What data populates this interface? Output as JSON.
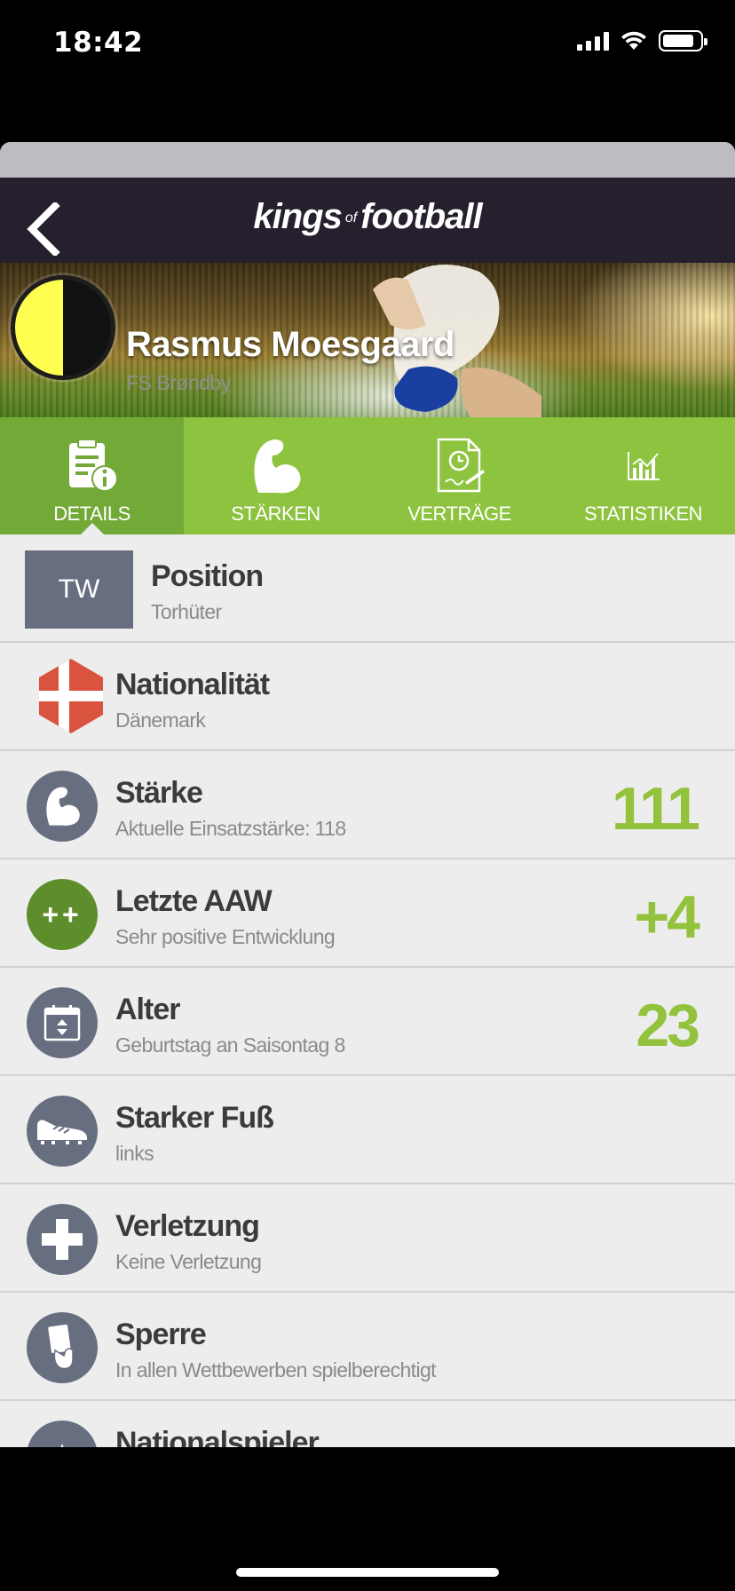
{
  "status": {
    "time": "18:42",
    "battery_level": 0.84
  },
  "app": {
    "logo_kings": "kings",
    "logo_of": "of",
    "logo_football": "football"
  },
  "player": {
    "name": "Rasmus Moesgaard",
    "club": "FS Brøndby",
    "club_colors": [
      "#ffff52",
      "#111111"
    ]
  },
  "tabs": [
    {
      "label": "DETAILS",
      "icon": "details-document-icon",
      "active": true
    },
    {
      "label": "STÄRKEN",
      "icon": "flexed-arm-icon",
      "active": false
    },
    {
      "label": "VERTRÄGE",
      "icon": "contract-icon",
      "active": false
    },
    {
      "label": "STATISTIKEN",
      "icon": "bar-chart-icon",
      "active": false
    }
  ],
  "details": {
    "position": {
      "badge": "TW",
      "title": "Position",
      "subtitle": "Torhüter"
    },
    "nationality": {
      "title": "Nationalität",
      "subtitle": "Dänemark",
      "icon": "denmark-flag-icon"
    },
    "strength": {
      "title": "Stärke",
      "subtitle": "Aktuelle Einsatzstärke: 118",
      "value": "111",
      "icon": "flexed-arm-icon"
    },
    "last_aaw": {
      "title": "Letzte AAW",
      "subtitle": "Sehr positive Entwicklung",
      "value": "+4",
      "icon": "double-plus-icon",
      "icon_text": "++"
    },
    "age": {
      "title": "Alter",
      "subtitle": "Geburtstag an Saisontag 8",
      "value": "23",
      "icon": "calendar-icon"
    },
    "foot": {
      "title": "Starker Fuß",
      "subtitle": "links",
      "icon": "football-boot-icon"
    },
    "injury": {
      "title": "Verletzung",
      "subtitle": "Keine Verletzung",
      "icon": "medical-cross-icon"
    },
    "suspension": {
      "title": "Sperre",
      "subtitle": "In allen Wettbewerben spielberechtigt",
      "icon": "referee-card-icon"
    },
    "national": {
      "title": "Nationalspieler",
      "icon": "star-icon"
    }
  },
  "colors": {
    "accent_green": "#8dc33f",
    "active_tab_green": "#73a936",
    "value_green": "#93c23d",
    "icon_gray": "#676e80",
    "nav_dark": "#26202e"
  }
}
